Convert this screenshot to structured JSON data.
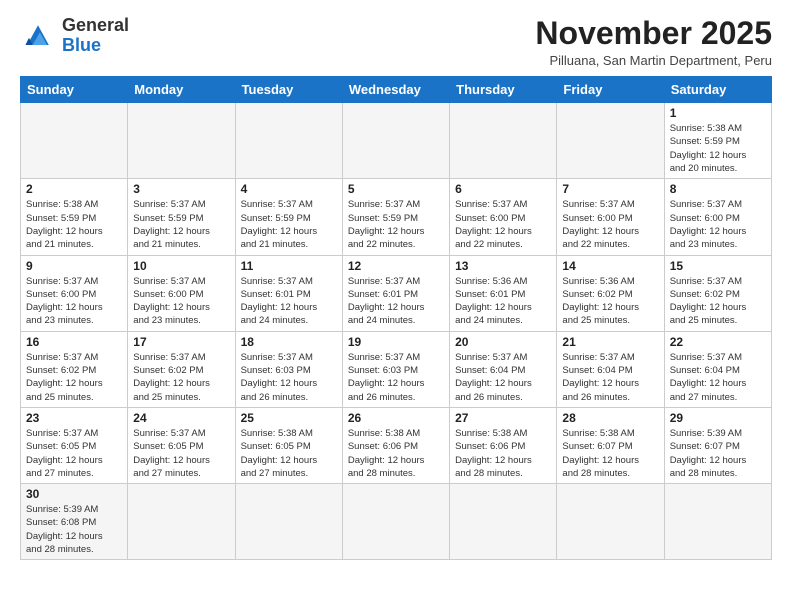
{
  "logo": {
    "line1": "General",
    "line2": "Blue"
  },
  "title": "November 2025",
  "subtitle": "Pilluana, San Martin Department, Peru",
  "days_of_week": [
    "Sunday",
    "Monday",
    "Tuesday",
    "Wednesday",
    "Thursday",
    "Friday",
    "Saturday"
  ],
  "weeks": [
    [
      {
        "day": "",
        "info": "",
        "empty": true
      },
      {
        "day": "",
        "info": "",
        "empty": true
      },
      {
        "day": "",
        "info": "",
        "empty": true
      },
      {
        "day": "",
        "info": "",
        "empty": true
      },
      {
        "day": "",
        "info": "",
        "empty": true
      },
      {
        "day": "",
        "info": "",
        "empty": true
      },
      {
        "day": "1",
        "info": "Sunrise: 5:38 AM\nSunset: 5:59 PM\nDaylight: 12 hours\nand 20 minutes."
      }
    ],
    [
      {
        "day": "2",
        "info": "Sunrise: 5:38 AM\nSunset: 5:59 PM\nDaylight: 12 hours\nand 21 minutes."
      },
      {
        "day": "3",
        "info": "Sunrise: 5:37 AM\nSunset: 5:59 PM\nDaylight: 12 hours\nand 21 minutes."
      },
      {
        "day": "4",
        "info": "Sunrise: 5:37 AM\nSunset: 5:59 PM\nDaylight: 12 hours\nand 21 minutes."
      },
      {
        "day": "5",
        "info": "Sunrise: 5:37 AM\nSunset: 5:59 PM\nDaylight: 12 hours\nand 22 minutes."
      },
      {
        "day": "6",
        "info": "Sunrise: 5:37 AM\nSunset: 6:00 PM\nDaylight: 12 hours\nand 22 minutes."
      },
      {
        "day": "7",
        "info": "Sunrise: 5:37 AM\nSunset: 6:00 PM\nDaylight: 12 hours\nand 22 minutes."
      },
      {
        "day": "8",
        "info": "Sunrise: 5:37 AM\nSunset: 6:00 PM\nDaylight: 12 hours\nand 23 minutes."
      }
    ],
    [
      {
        "day": "9",
        "info": "Sunrise: 5:37 AM\nSunset: 6:00 PM\nDaylight: 12 hours\nand 23 minutes."
      },
      {
        "day": "10",
        "info": "Sunrise: 5:37 AM\nSunset: 6:00 PM\nDaylight: 12 hours\nand 23 minutes."
      },
      {
        "day": "11",
        "info": "Sunrise: 5:37 AM\nSunset: 6:01 PM\nDaylight: 12 hours\nand 24 minutes."
      },
      {
        "day": "12",
        "info": "Sunrise: 5:37 AM\nSunset: 6:01 PM\nDaylight: 12 hours\nand 24 minutes."
      },
      {
        "day": "13",
        "info": "Sunrise: 5:36 AM\nSunset: 6:01 PM\nDaylight: 12 hours\nand 24 minutes."
      },
      {
        "day": "14",
        "info": "Sunrise: 5:36 AM\nSunset: 6:02 PM\nDaylight: 12 hours\nand 25 minutes."
      },
      {
        "day": "15",
        "info": "Sunrise: 5:37 AM\nSunset: 6:02 PM\nDaylight: 12 hours\nand 25 minutes."
      }
    ],
    [
      {
        "day": "16",
        "info": "Sunrise: 5:37 AM\nSunset: 6:02 PM\nDaylight: 12 hours\nand 25 minutes."
      },
      {
        "day": "17",
        "info": "Sunrise: 5:37 AM\nSunset: 6:02 PM\nDaylight: 12 hours\nand 25 minutes."
      },
      {
        "day": "18",
        "info": "Sunrise: 5:37 AM\nSunset: 6:03 PM\nDaylight: 12 hours\nand 26 minutes."
      },
      {
        "day": "19",
        "info": "Sunrise: 5:37 AM\nSunset: 6:03 PM\nDaylight: 12 hours\nand 26 minutes."
      },
      {
        "day": "20",
        "info": "Sunrise: 5:37 AM\nSunset: 6:04 PM\nDaylight: 12 hours\nand 26 minutes."
      },
      {
        "day": "21",
        "info": "Sunrise: 5:37 AM\nSunset: 6:04 PM\nDaylight: 12 hours\nand 26 minutes."
      },
      {
        "day": "22",
        "info": "Sunrise: 5:37 AM\nSunset: 6:04 PM\nDaylight: 12 hours\nand 27 minutes."
      }
    ],
    [
      {
        "day": "23",
        "info": "Sunrise: 5:37 AM\nSunset: 6:05 PM\nDaylight: 12 hours\nand 27 minutes."
      },
      {
        "day": "24",
        "info": "Sunrise: 5:37 AM\nSunset: 6:05 PM\nDaylight: 12 hours\nand 27 minutes."
      },
      {
        "day": "25",
        "info": "Sunrise: 5:38 AM\nSunset: 6:05 PM\nDaylight: 12 hours\nand 27 minutes."
      },
      {
        "day": "26",
        "info": "Sunrise: 5:38 AM\nSunset: 6:06 PM\nDaylight: 12 hours\nand 28 minutes."
      },
      {
        "day": "27",
        "info": "Sunrise: 5:38 AM\nSunset: 6:06 PM\nDaylight: 12 hours\nand 28 minutes."
      },
      {
        "day": "28",
        "info": "Sunrise: 5:38 AM\nSunset: 6:07 PM\nDaylight: 12 hours\nand 28 minutes."
      },
      {
        "day": "29",
        "info": "Sunrise: 5:39 AM\nSunset: 6:07 PM\nDaylight: 12 hours\nand 28 minutes."
      }
    ],
    [
      {
        "day": "30",
        "info": "Sunrise: 5:39 AM\nSunset: 6:08 PM\nDaylight: 12 hours\nand 28 minutes.",
        "last": true
      },
      {
        "day": "",
        "info": "",
        "empty": true,
        "last": true
      },
      {
        "day": "",
        "info": "",
        "empty": true,
        "last": true
      },
      {
        "day": "",
        "info": "",
        "empty": true,
        "last": true
      },
      {
        "day": "",
        "info": "",
        "empty": true,
        "last": true
      },
      {
        "day": "",
        "info": "",
        "empty": true,
        "last": true
      },
      {
        "day": "",
        "info": "",
        "empty": true,
        "last": true
      }
    ]
  ]
}
